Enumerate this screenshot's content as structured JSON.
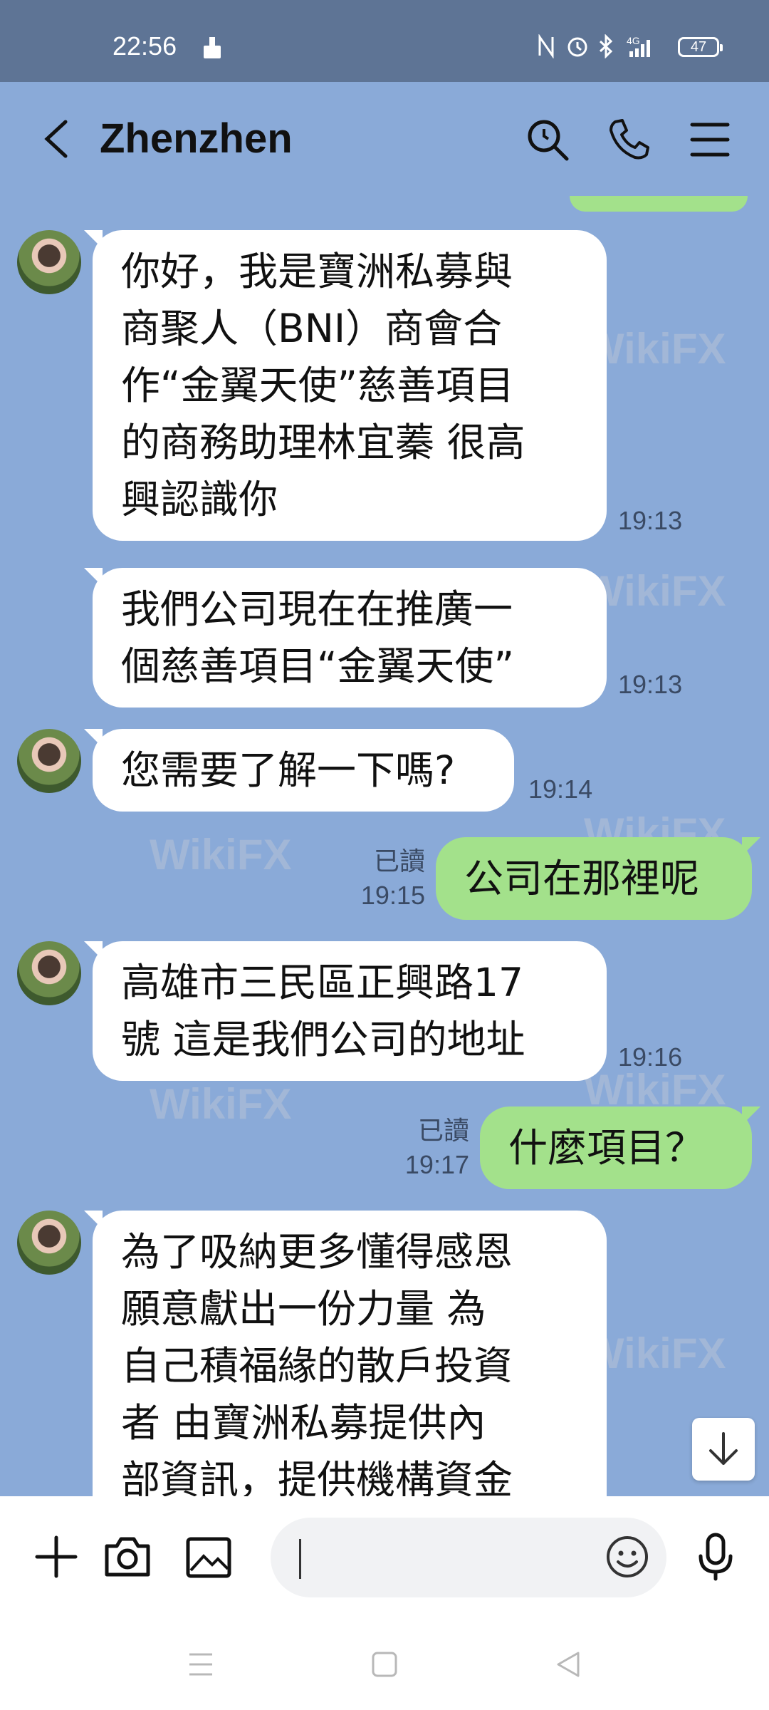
{
  "status_bar": {
    "time": "22:56",
    "battery": "47",
    "icons": [
      "cleaner-icon",
      "nfc-icon",
      "alarm-icon",
      "bluetooth-icon",
      "signal-4g-icon",
      "battery-icon"
    ]
  },
  "header": {
    "title": "Zhenzhen",
    "icons": [
      "back-icon",
      "search-icon",
      "phone-icon",
      "menu-icon"
    ]
  },
  "messages": [
    {
      "direction": "in",
      "lines": [
        "你好，我是寶洲私募與",
        "商聚人（BNI）商會合",
        "作“金翼天使”慈善項目",
        "的商務助理林宜蓁  很高",
        "興認識你"
      ],
      "time": "19:13",
      "avatar": true
    },
    {
      "direction": "in",
      "lines": [
        "我們公司現在在推廣一",
        "個慈善項目“金翼天使”"
      ],
      "time": "19:13",
      "avatar": false
    },
    {
      "direction": "in",
      "lines": [
        "您需要了解一下嗎?"
      ],
      "time": "19:14",
      "avatar": true
    },
    {
      "direction": "out",
      "lines": [
        "公司在那裡呢"
      ],
      "read": "已讀",
      "time": "19:15"
    },
    {
      "direction": "in",
      "lines": [
        "高雄市三民區正興路17",
        "號 這是我們公司的地址"
      ],
      "time": "19:16",
      "avatar": true
    },
    {
      "direction": "out",
      "lines": [
        "什麼項目？"
      ],
      "read": "已讀",
      "time": "19:17"
    },
    {
      "direction": "in",
      "lines": [
        "為了吸納更多懂得感恩",
        "願意獻出一份力量 為",
        "自己積福緣的散戶投資",
        "者 由寶洲私募提供內",
        "部資訊，提供機構資金"
      ],
      "avatar": true
    }
  ],
  "watermark": "WikiFX",
  "input_bar": {
    "placeholder": "",
    "icons": [
      "plus-icon",
      "camera-icon",
      "image-icon",
      "emoji-icon",
      "microphone-icon"
    ]
  },
  "colors": {
    "chat_background": "#8aaad8",
    "status_bar": "#5e7495",
    "incoming_bubble": "#ffffff",
    "outgoing_bubble": "#a3e18b"
  }
}
